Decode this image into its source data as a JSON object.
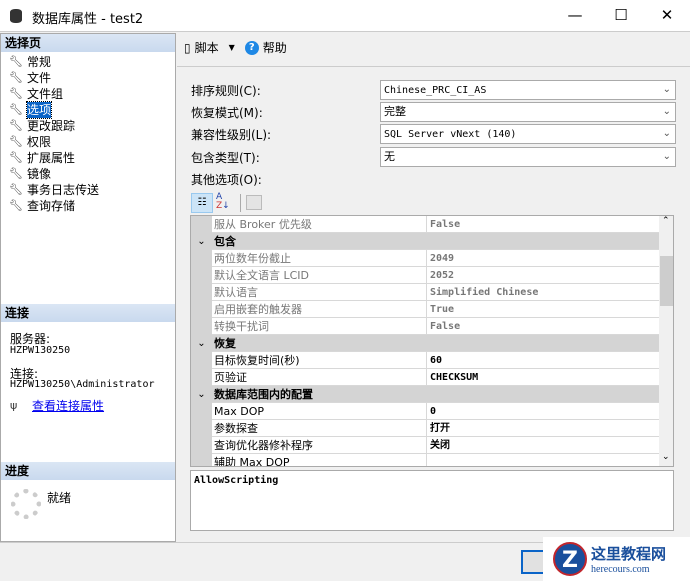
{
  "window": {
    "title": "数据库属性 - test2",
    "minimize": "—",
    "maximize": "☐",
    "close": "✕"
  },
  "left": {
    "select_page_header": "选择页",
    "pages": [
      "常规",
      "文件",
      "文件组",
      "选项",
      "更改跟踪",
      "权限",
      "扩展属性",
      "镜像",
      "事务日志传送",
      "查询存储"
    ],
    "selected_index": 3,
    "connection_header": "连接",
    "server_label": "服务器:",
    "server_value": "HZPW130250",
    "connection_label": "连接:",
    "connection_value": "HZPW130250\\Administrator",
    "view_connection_link": "查看连接属性",
    "progress_header": "进度",
    "progress_status": "就绪"
  },
  "toolbar": {
    "script_label": "脚本",
    "help_label": "帮助"
  },
  "form": {
    "collation_label": "排序规则(C):",
    "collation_value": "Chinese_PRC_CI_AS",
    "recovery_label": "恢复模式(M):",
    "recovery_value": "完整",
    "compat_label": "兼容性级别(L):",
    "compat_value": "SQL Server vNext (140)",
    "containment_label": "包含类型(T):",
    "containment_value": "无",
    "other_label": "其他选项(O):"
  },
  "grid": {
    "rows": [
      {
        "k": "服从 Broker 优先级",
        "v": "False",
        "dim": true
      },
      {
        "cat": true,
        "k": "包含"
      },
      {
        "k": "两位数年份截止",
        "v": "2049",
        "dim": true
      },
      {
        "k": "默认全文语言 LCID",
        "v": "2052",
        "dim": true
      },
      {
        "k": "默认语言",
        "v": "Simplified Chinese",
        "dim": true
      },
      {
        "k": "启用嵌套的触发器",
        "v": "True",
        "dim": true
      },
      {
        "k": "转换干扰词",
        "v": "False",
        "dim": true
      },
      {
        "cat": true,
        "k": "恢复"
      },
      {
        "k": "目标恢复时间(秒)",
        "v": "60"
      },
      {
        "k": "页验证",
        "v": "CHECKSUM"
      },
      {
        "cat": true,
        "k": "数据库范围内的配置"
      },
      {
        "k": "Max DOP",
        "v": "0"
      },
      {
        "k": "参数探查",
        "v": "打开"
      },
      {
        "k": "查询优化器修补程序",
        "v": "关闭"
      },
      {
        "k": "辅助 Max DOP",
        "v": ""
      }
    ],
    "description": "AllowScripting"
  },
  "watermark": {
    "title": "这里教程网",
    "url": "herecours.com"
  }
}
